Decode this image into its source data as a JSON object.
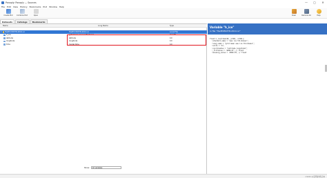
{
  "window": {
    "title": "Panoply: Panoply — Sources",
    "controls": [
      "—",
      "▢",
      "✕"
    ]
  },
  "menu": [
    "File",
    "Edit",
    "View",
    "History",
    "Bookmarks",
    "Plot",
    "Window",
    "Help"
  ],
  "toolbar": {
    "left": [
      "Create Plot",
      "Combine Plot",
      "Open"
    ],
    "right": [
      "Clear",
      "Remove All",
      "Help"
    ]
  },
  "tabs": [
    "Datasets",
    "Catalogs",
    "Bookmarks"
  ],
  "tree": {
    "columns": [
      "Name",
      "Long Name",
      "Type"
    ],
    "rows": [
      {
        "name": "HadEX 89378-2014.nc",
        "long_name": "HadEX 89378-2014.nc",
        "type": "Local File",
        "indent": 0,
        "selected": true
      },
      {
        "name": "h_ice",
        "long_name": "grid mean sea ice thickness",
        "type": "Geo2D",
        "indent": 1,
        "selected": false
      },
      {
        "name": "latitude",
        "long_name": "latitude",
        "type": "1D",
        "indent": 1,
        "selected": false
      },
      {
        "name": "longitude",
        "long_name": "longitude",
        "type": "1D",
        "indent": 1,
        "selected": false
      },
      {
        "name": "time",
        "long_name": "model time",
        "type": "1D",
        "indent": 1,
        "selected": false
      }
    ]
  },
  "show_filter": {
    "label": "Show:",
    "value": "All variables"
  },
  "info": {
    "title": "Variable \"h_ice\"",
    "subtitle": "in file \"HadEX89378-2014.nc\"",
    "lines": [
      "float h_ice(time=40, y=361, x=361);",
      "  :standard_name = \"sea ice thickness\";",
      "  :long_name = \"grid mean sea ice thickness\";",
      "  :units = \"m\";",
      "  :coordinates = \"latitude longitude\";",
      "  :_FillValue = -9999.0f; // float",
      "  :missing_value = -9999.0f; // float"
    ]
  },
  "watermark": "CSDN @吴明的笔记本",
  "colors": {
    "accent": "#3671c4",
    "selection": "#3177d4",
    "highlight": "#e0141e"
  },
  "icons": {
    "create-plot": "chart-icon",
    "combine-plot": "combine-chart-icon",
    "open": "open-icon",
    "clear": "broom-icon",
    "remove-all": "trash-icon",
    "help": "help-icon"
  }
}
